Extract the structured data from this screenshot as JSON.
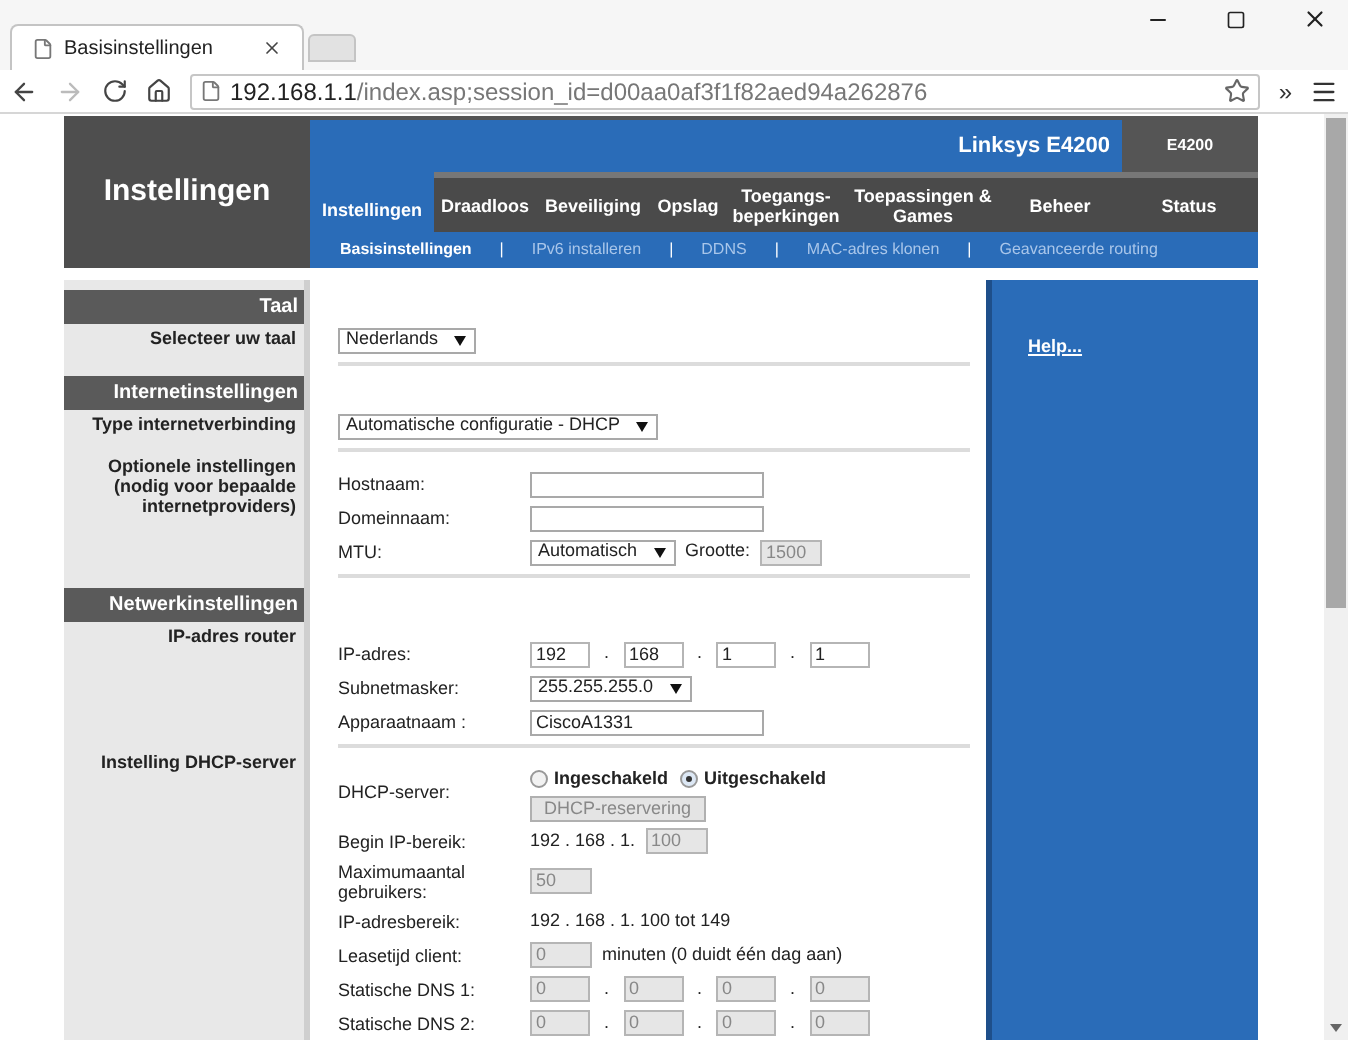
{
  "browser": {
    "tabs": [
      {
        "title": "Basisinstellingen",
        "selected": true
      },
      {
        "selected": false
      }
    ],
    "address": {
      "host": "192.168.1.1",
      "path": "/index.asp;session_id=d00aa0af3f1f82aed94a262876"
    },
    "overflow": "»"
  },
  "header": {
    "title": "Instellingen",
    "model": "Linksys E4200",
    "badge": "E4200"
  },
  "tabs": [
    {
      "label": "Instellingen",
      "selected": true
    },
    {
      "label": "Draadloos",
      "selected": false
    },
    {
      "label": "Beveiliging",
      "selected": false
    },
    {
      "label": "Opslag",
      "selected": false
    },
    {
      "label": "Toegangs-beperkingen",
      "selected": false
    },
    {
      "label": "Toepassingen & Games",
      "selected": false
    },
    {
      "label": "Beheer",
      "selected": false
    },
    {
      "label": "Status",
      "selected": false
    }
  ],
  "subtabs": [
    {
      "label": "Basisinstellingen",
      "selected": true
    },
    {
      "separator": "|",
      "label": "IPv6 installeren",
      "selected": false
    },
    {
      "separator": "|",
      "label": "DDNS",
      "selected": false
    },
    {
      "separator": "|",
      "label": "MAC-adres klonen",
      "selected": false
    },
    {
      "separator": "|",
      "label": "Geavanceerde routing",
      "selected": false
    }
  ],
  "sections": [
    {
      "heading": "Taal",
      "groups": [
        {
          "label": "Selecteer uw taal",
          "rows": [
            {
              "items": [
                {
                  "kind": "select",
                  "value": "Nederlands"
                }
              ]
            }
          ]
        }
      ]
    },
    {
      "heading": "Internetinstellingen",
      "groups": [
        {
          "label": "Type internetverbinding",
          "rows": [
            {
              "items": [
                {
                  "kind": "select",
                  "value": "Automatische configuratie - DHCP"
                }
              ]
            }
          ]
        },
        {
          "label": "Optionele instellingen (nodig voor bepaalde internetproviders)",
          "rows": [
            {
              "label": "Hostnaam:",
              "items": [
                {
                  "kind": "input",
                  "disabled": false
                }
              ]
            },
            {
              "label": "Domeinnaam:",
              "items": [
                {
                  "kind": "input",
                  "disabled": false
                }
              ]
            },
            {
              "label": "MTU:",
              "items": [
                {
                  "kind": "select",
                  "value": "Automatisch"
                },
                {
                  "kind": "text",
                  "value": "Grootte:"
                },
                {
                  "kind": "small",
                  "value": "1500",
                  "disabled": true
                }
              ]
            }
          ]
        }
      ]
    },
    {
      "heading": "Netwerkinstellingen",
      "groups": [
        {
          "label": "IP-adres router",
          "rows": [
            {
              "label": "IP-adres:",
              "items": [
                {
                  "kind": "octet",
                  "value": "192",
                  "disabled": false
                },
                {
                  "kind": "sep",
                  "value": "."
                },
                {
                  "kind": "octet",
                  "value": "168",
                  "disabled": false
                },
                {
                  "kind": "sep",
                  "value": "."
                },
                {
                  "kind": "octet",
                  "value": "1",
                  "disabled": false
                },
                {
                  "kind": "sep",
                  "value": "."
                },
                {
                  "kind": "octet",
                  "value": "1",
                  "disabled": false
                }
              ]
            },
            {
              "label": "Subnetmasker:",
              "items": [
                {
                  "kind": "select",
                  "value": "255.255.255.0"
                }
              ]
            },
            {
              "label": "Apparaatnaam :",
              "items": [
                {
                  "kind": "input",
                  "value": "CiscoA1331",
                  "disabled": false
                }
              ]
            }
          ]
        },
        {
          "label": "Instelling DHCP-server",
          "rows": [
            {
              "label": "DHCP-server:",
              "items": [
                {
                  "kind": "radio",
                  "value": "Ingeschakeld",
                  "selected": false
                },
                {
                  "kind": "radio",
                  "value": "Uitgeschakeld",
                  "selected": true
                }
              ],
              "button": {
                "label": "DHCP-reservering",
                "disabled": true
              }
            },
            {
              "label": "Begin IP-bereik:",
              "items": [
                {
                  "kind": "text",
                  "value": "192 . 168 . 1."
                },
                {
                  "kind": "small",
                  "value": "100",
                  "disabled": true
                }
              ]
            },
            {
              "label": "Maximumaantal gebruikers:",
              "items": [
                {
                  "kind": "small",
                  "value": "50",
                  "disabled": true
                }
              ]
            },
            {
              "label": "IP-adresbereik:",
              "items": [
                {
                  "kind": "text",
                  "value": "192 . 168 . 1. 100 tot 149"
                }
              ]
            },
            {
              "label": "Leasetijd client:",
              "items": [
                {
                  "kind": "small",
                  "value": "0",
                  "disabled": true
                },
                {
                  "kind": "text",
                  "value": "minuten (0 duidt één dag aan)"
                }
              ]
            },
            {
              "label": "Statische DNS 1:",
              "items": [
                {
                  "kind": "octet",
                  "value": "0",
                  "disabled": true
                },
                {
                  "kind": "sep",
                  "value": "."
                },
                {
                  "kind": "octet",
                  "value": "0",
                  "disabled": true
                },
                {
                  "kind": "sep",
                  "value": "."
                },
                {
                  "kind": "octet",
                  "value": "0",
                  "disabled": true
                },
                {
                  "kind": "sep",
                  "value": "."
                },
                {
                  "kind": "octet",
                  "value": "0",
                  "disabled": true
                }
              ]
            },
            {
              "label": "Statische DNS 2:",
              "items": [
                {
                  "kind": "octet",
                  "value": "0",
                  "disabled": true
                },
                {
                  "kind": "sep",
                  "value": "."
                },
                {
                  "kind": "octet",
                  "value": "0",
                  "disabled": true
                },
                {
                  "kind": "sep",
                  "value": "."
                },
                {
                  "kind": "octet",
                  "value": "0",
                  "disabled": true
                },
                {
                  "kind": "sep",
                  "value": "."
                },
                {
                  "kind": "octet",
                  "value": "0",
                  "disabled": true
                }
              ]
            }
          ]
        }
      ]
    }
  ],
  "help": {
    "link": "Help..."
  }
}
